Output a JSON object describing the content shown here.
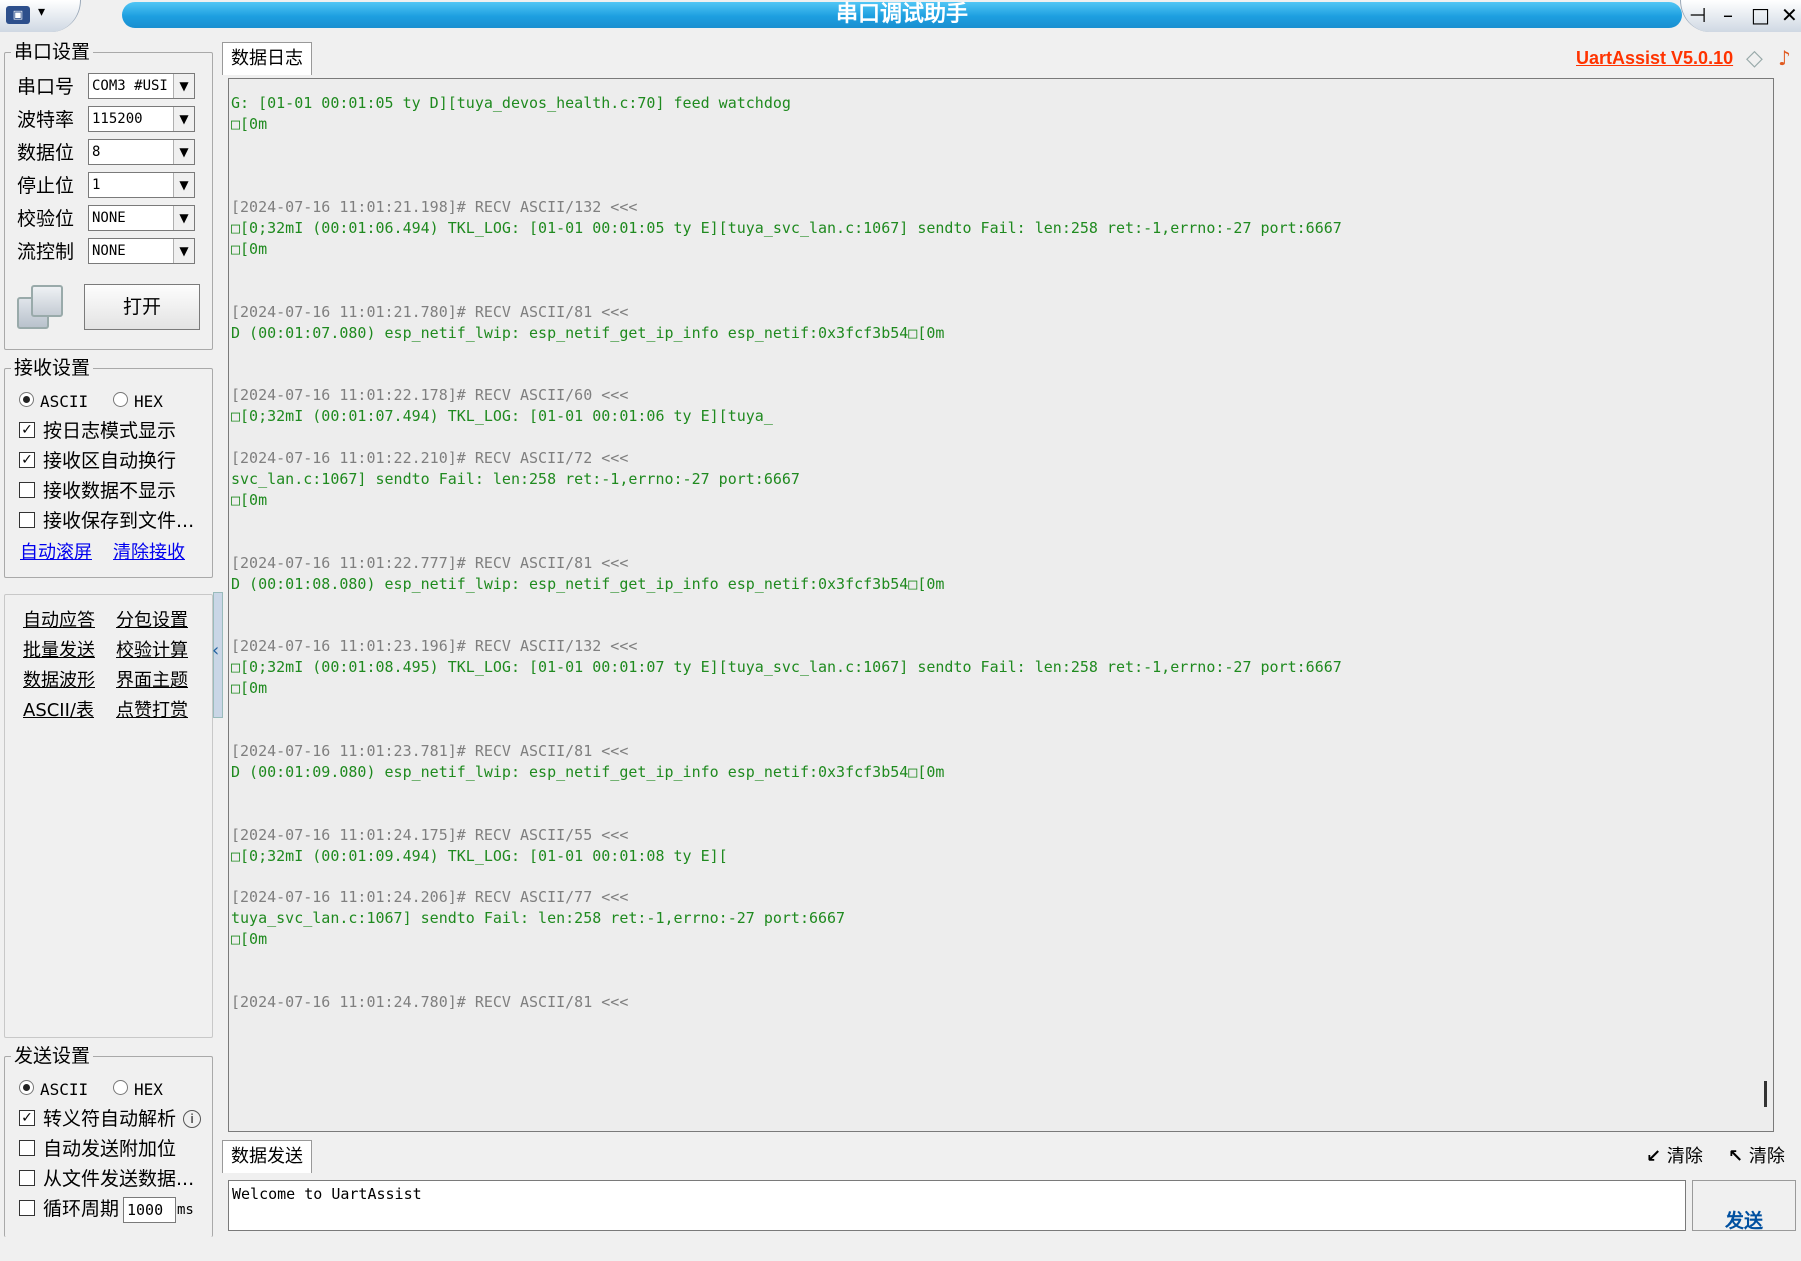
{
  "window": {
    "title": "串口调试助手",
    "brand": "UartAssist V5.0.10"
  },
  "serial_settings": {
    "title": "串口设置",
    "port": {
      "label": "串口号",
      "value": "COM3 #USI"
    },
    "baud": {
      "label": "波特率",
      "value": "115200"
    },
    "databits": {
      "label": "数据位",
      "value": "8"
    },
    "stopbits": {
      "label": "停止位",
      "value": "1"
    },
    "parity": {
      "label": "校验位",
      "value": "NONE"
    },
    "flow": {
      "label": "流控制",
      "value": "NONE"
    },
    "open_button": "打开"
  },
  "receive_settings": {
    "title": "接收设置",
    "ascii": "ASCII",
    "hex": "HEX",
    "log_mode": "按日志模式显示",
    "auto_wrap": "接收区自动换行",
    "hide_data": "接收数据不显示",
    "save_file": "接收保存到文件...",
    "auto_scroll": "自动滚屏",
    "clear_recv": "清除接收"
  },
  "tools": {
    "auto_reply": "自动应答",
    "packet_settings": "分包设置",
    "batch_send": "批量发送",
    "checksum": "校验计算",
    "waveform": "数据波形",
    "theme": "界面主题",
    "ascii_table": "ASCII/表",
    "tip": "点赞打赏"
  },
  "send_settings": {
    "title": "发送设置",
    "ascii": "ASCII",
    "hex": "HEX",
    "escape_parse": "转义符自动解析",
    "append_bit": "自动发送附加位",
    "from_file": "从文件发送数据...",
    "loop_period": "循环周期",
    "period_value": "1000",
    "period_unit": "ms"
  },
  "log": {
    "tab": "数据日志",
    "lines": [
      {
        "kind": "d",
        "text": "G: [01-01 00:01:05 ty D][tuya_devos_health.c:70] feed watchdog"
      },
      {
        "kind": "d",
        "text": "□[0m"
      },
      {
        "kind": "h",
        "text": "[2024-07-16 11:01:21.198]# RECV ASCII/132 <<<"
      },
      {
        "kind": "d",
        "text": "□[0;32mI (00:01:06.494) TKL_LOG: [01-01 00:01:05 ty E][tuya_svc_lan.c:1067] sendto Fail: len:258 ret:-1,errno:-27 port:6667"
      },
      {
        "kind": "d",
        "text": "□[0m"
      },
      {
        "kind": "h",
        "text": "[2024-07-16 11:01:21.780]# RECV ASCII/81 <<<"
      },
      {
        "kind": "d",
        "text": "D (00:01:07.080) esp_netif_lwip: esp_netif_get_ip_info esp_netif:0x3fcf3b54□[0m"
      },
      {
        "kind": "h",
        "text": "[2024-07-16 11:01:22.178]# RECV ASCII/60 <<<"
      },
      {
        "kind": "d",
        "text": "□[0;32mI (00:01:07.494) TKL_LOG: [01-01 00:01:06 ty E][tuya_"
      },
      {
        "kind": "h",
        "text": "[2024-07-16 11:01:22.210]# RECV ASCII/72 <<<"
      },
      {
        "kind": "d",
        "text": "svc_lan.c:1067] sendto Fail: len:258 ret:-1,errno:-27 port:6667"
      },
      {
        "kind": "d",
        "text": "□[0m"
      },
      {
        "kind": "h",
        "text": "[2024-07-16 11:01:22.777]# RECV ASCII/81 <<<"
      },
      {
        "kind": "d",
        "text": "D (00:01:08.080) esp_netif_lwip: esp_netif_get_ip_info esp_netif:0x3fcf3b54□[0m"
      },
      {
        "kind": "h",
        "text": "[2024-07-16 11:01:23.196]# RECV ASCII/132 <<<"
      },
      {
        "kind": "d",
        "text": "□[0;32mI (00:01:08.495) TKL_LOG: [01-01 00:01:07 ty E][tuya_svc_lan.c:1067] sendto Fail: len:258 ret:-1,errno:-27 port:6667"
      },
      {
        "kind": "d",
        "text": "□[0m"
      },
      {
        "kind": "h",
        "text": "[2024-07-16 11:01:23.781]# RECV ASCII/81 <<<"
      },
      {
        "kind": "d",
        "text": "D (00:01:09.080) esp_netif_lwip: esp_netif_get_ip_info esp_netif:0x3fcf3b54□[0m"
      },
      {
        "kind": "h",
        "text": "[2024-07-16 11:01:24.175]# RECV ASCII/55 <<<"
      },
      {
        "kind": "d",
        "text": "□[0;32mI (00:01:09.494) TKL_LOG: [01-01 00:01:08 ty E]["
      },
      {
        "kind": "h",
        "text": "[2024-07-16 11:01:24.206]# RECV ASCII/77 <<<"
      },
      {
        "kind": "d",
        "text": "tuya_svc_lan.c:1067] sendto Fail: len:258 ret:-1,errno:-27 port:6667"
      },
      {
        "kind": "d",
        "text": "□[0m"
      },
      {
        "kind": "h",
        "text": "[2024-07-16 11:01:24.780]# RECV ASCII/81 <<<"
      }
    ]
  },
  "send": {
    "tab": "数据发送",
    "clear1": "清除",
    "clear2": "清除",
    "text": "Welcome to UartAssist",
    "button": "发送"
  }
}
